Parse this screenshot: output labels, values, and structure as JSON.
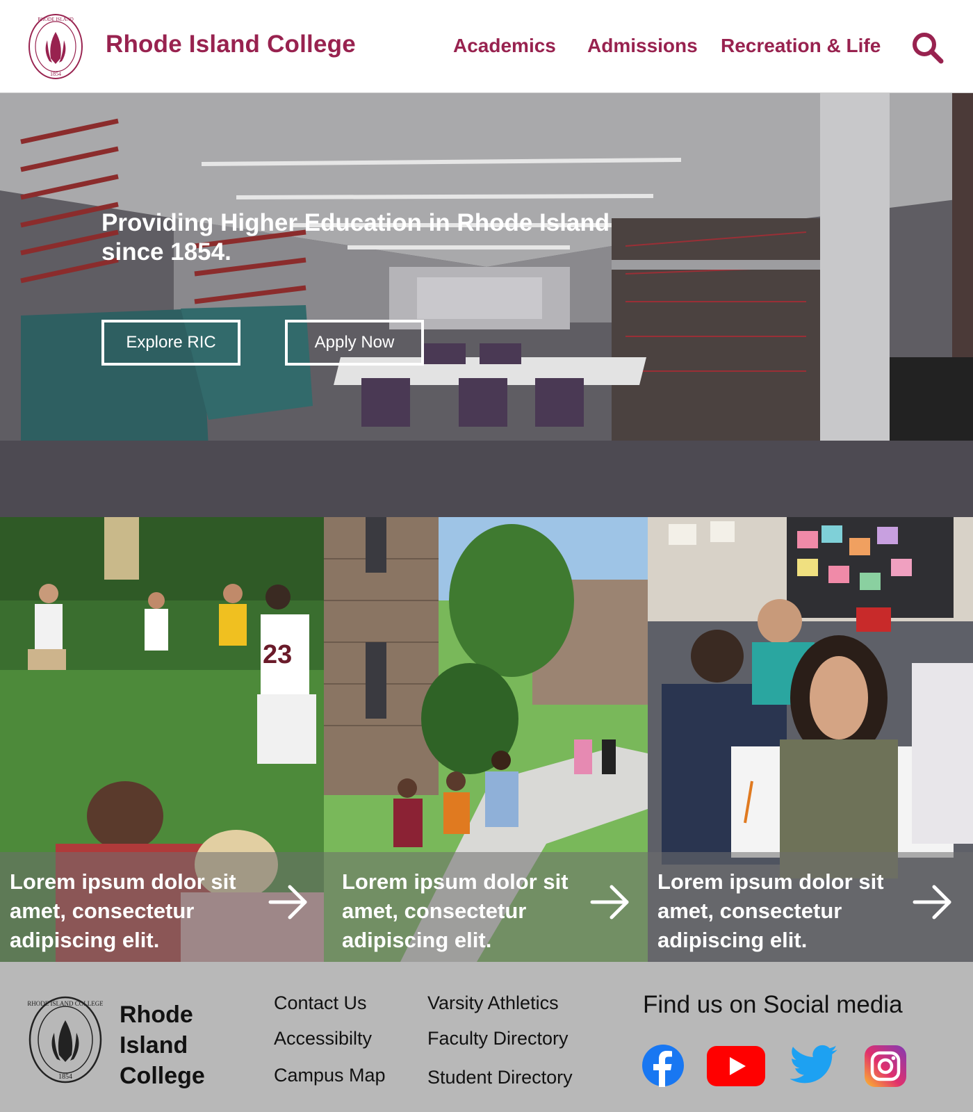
{
  "header": {
    "brand": "Rhode Island College",
    "seal_text": "RHODE ISLAND COLLEGE",
    "seal_year": "1854",
    "nav": [
      "Academics",
      "Admissions",
      "Recreation & Life"
    ]
  },
  "hero": {
    "title": "Providing Higher Education in Rhode Island since 1854.",
    "buttons": [
      "Explore RIC",
      "Apply Now"
    ],
    "jersey_number": "23"
  },
  "cards": [
    {
      "text": "Lorem ipsum dolor sit amet, consectetur adipiscing elit."
    },
    {
      "text": "Lorem ipsum dolor sit amet, consectetur adipiscing elit."
    },
    {
      "text": "Lorem ipsum dolor sit amet, consectetur adipiscing elit."
    }
  ],
  "footer": {
    "brand_lines": [
      "Rhode",
      "Island",
      "College"
    ],
    "links_col1": [
      "Contact Us",
      "Accessibilty",
      "Campus Map"
    ],
    "links_col2": [
      "Varsity Athletics",
      "Faculty Directory",
      "Student Directory"
    ],
    "social_title": "Find us on Social media",
    "social": [
      "facebook-icon",
      "youtube-icon",
      "twitter-icon",
      "instagram-icon"
    ]
  },
  "colors": {
    "brand": "#98224f",
    "footer_bg": "#b8b8b8",
    "facebook": "#1877f2",
    "youtube": "#ff0000",
    "twitter": "#1da1f2"
  }
}
